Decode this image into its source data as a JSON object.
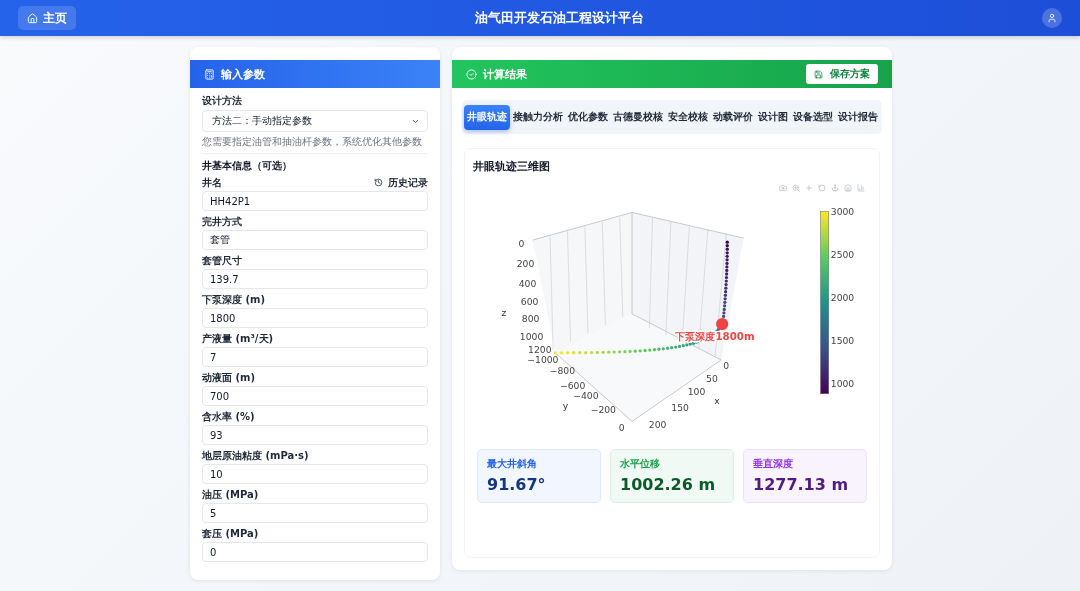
{
  "header": {
    "home_button": "主页",
    "title": "油气田开发石油工程设计平台"
  },
  "input_panel": {
    "title": "输入参数",
    "method": {
      "label": "设计方法",
      "value": "方法二：手动指定参数",
      "hint": "您需要指定油管和抽油杆参数，系统优化其他参数"
    },
    "section_title": "井基本信息（可选）",
    "history_button": "历史记录",
    "fields": [
      {
        "label": "井名",
        "value": "HH42P1"
      },
      {
        "label": "完井方式",
        "value": "套管"
      },
      {
        "label": "套管尺寸",
        "value": "139.7"
      },
      {
        "label": "下泵深度 (m)",
        "value": "1800"
      },
      {
        "label": "产液量 (m³/天)",
        "value": "7"
      },
      {
        "label": "动液面 (m)",
        "value": "700"
      },
      {
        "label": "含水率 (%)",
        "value": "93"
      },
      {
        "label": "地层原油粘度 (mPa·s)",
        "value": "10"
      },
      {
        "label": "油压 (MPa)",
        "value": "5"
      },
      {
        "label": "套压 (MPa)",
        "value": "0"
      }
    ]
  },
  "results_panel": {
    "title": "计算结果",
    "save_button": "保存方案",
    "tabs": [
      {
        "label": "井眼轨迹",
        "selected": true
      },
      {
        "label": "接触力分析",
        "selected": false
      },
      {
        "label": "优化参数",
        "selected": false
      },
      {
        "label": "古德曼校核",
        "selected": false
      },
      {
        "label": "安全校核",
        "selected": false
      },
      {
        "label": "动载评价",
        "selected": false
      },
      {
        "label": "设计图",
        "selected": false
      },
      {
        "label": "设备选型",
        "selected": false
      },
      {
        "label": "设计报告",
        "selected": false
      }
    ],
    "plot": {
      "title": "井眼轨迹三维图",
      "marker_label": "下泵深度1800m",
      "z_axis": {
        "label": "z",
        "ticks": [
          "0",
          "200",
          "400",
          "600",
          "800",
          "1000",
          "1200"
        ]
      },
      "y_axis": {
        "label": "y",
        "ticks": [
          "−1000",
          "−800",
          "−600",
          "−400",
          "−200",
          "0"
        ]
      },
      "x_axis": {
        "label": "x",
        "ticks": [
          "0",
          "50",
          "100",
          "150",
          "200"
        ]
      },
      "colorbar_ticks": [
        "3000",
        "2500",
        "2000",
        "1500",
        "1000"
      ]
    },
    "stats": [
      {
        "label": "最大井斜角",
        "value": "91.67°",
        "color": "#2563eb"
      },
      {
        "label": "水平位移",
        "value": "1002.26 m",
        "color": "#16a34a"
      },
      {
        "label": "垂直深度",
        "value": "1277.13 m",
        "color": "#9333ea"
      }
    ]
  }
}
